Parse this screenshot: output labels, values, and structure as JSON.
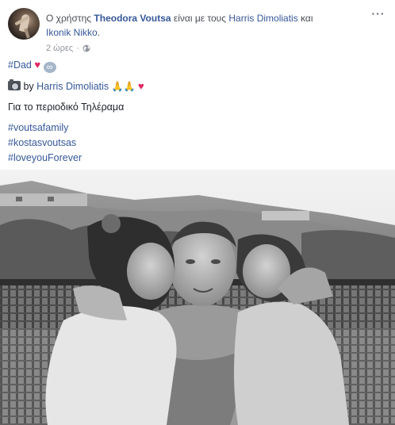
{
  "post": {
    "prefix": "Ο χρήστης",
    "author": "Theodora Voutsa",
    "with_text": "είναι με τους",
    "tagged_1": "Harris Dimoliatis",
    "and_text": "και",
    "tagged_2": "Ikonik Nikko",
    "period": ".",
    "time": "2 ώρες",
    "dot": "·",
    "more_label": "···",
    "lines": {
      "hashtag_dad": "#Dad",
      "by": "by",
      "photographer": "Harris Dimoliatis",
      "magazine": "Για το περιοδικό Τηλέραμα",
      "tag1": "#voutsafamily",
      "tag2": "#kostasvoutsas",
      "tag3": "#loveyouForever"
    },
    "emoji": {
      "heart": "♥",
      "infinity": "∞",
      "hands": "🙏🙏"
    }
  },
  "photo": {
    "style": "black-and-white",
    "subject": "man hugging two girls"
  }
}
